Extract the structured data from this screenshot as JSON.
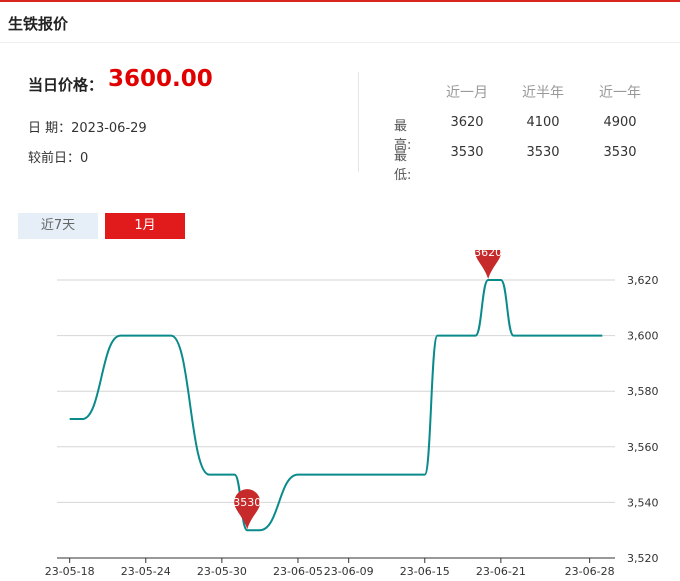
{
  "panel": {
    "title": "生铁报价"
  },
  "summary": {
    "price_label": "当日价格：",
    "price_value": "3600.00",
    "date_label": "日 期：",
    "date_value": "2023-06-29",
    "change_label": "较前日：",
    "change_value": "0"
  },
  "stats": {
    "headers": [
      "近一月",
      "近半年",
      "近一年"
    ],
    "rows": [
      {
        "label": "最高:",
        "values": [
          "3620",
          "4100",
          "4900"
        ]
      },
      {
        "label": "最低:",
        "values": [
          "3530",
          "3530",
          "3530"
        ]
      }
    ]
  },
  "tabs": [
    {
      "label": "近7天",
      "active": false
    },
    {
      "label": "1月",
      "active": true
    }
  ],
  "colors": {
    "accent": "#d7261e",
    "line": "#0a8a8a",
    "marker": "#c62a2a"
  },
  "chart_data": {
    "type": "line",
    "x_tick_labels": [
      "23-05-18",
      "23-05-24",
      "23-05-30",
      "23-06-05",
      "23-06-09",
      "23-06-15",
      "23-06-21",
      "23-06-28"
    ],
    "y_tick_labels": [
      "3,520",
      "3,540",
      "3,560",
      "3,580",
      "3,600",
      "3,620"
    ],
    "ylim": [
      3520,
      3620
    ],
    "grid": true,
    "series": [
      {
        "x": [
          "2023-05-18",
          "2023-05-19",
          "2023-05-22",
          "2023-05-23",
          "2023-05-24",
          "2023-05-25",
          "2023-05-26",
          "2023-05-29",
          "2023-05-30",
          "2023-05-31",
          "2023-06-01",
          "2023-06-02",
          "2023-06-05",
          "2023-06-06",
          "2023-06-07",
          "2023-06-08",
          "2023-06-09",
          "2023-06-12",
          "2023-06-13",
          "2023-06-14",
          "2023-06-15",
          "2023-06-16",
          "2023-06-19",
          "2023-06-20",
          "2023-06-21",
          "2023-06-22",
          "2023-06-25",
          "2023-06-26",
          "2023-06-27",
          "2023-06-28",
          "2023-06-29"
        ],
        "values": [
          3570,
          3570,
          3600,
          3600,
          3600,
          3600,
          3600,
          3550,
          3550,
          3550,
          3530,
          3530,
          3550,
          3550,
          3550,
          3550,
          3550,
          3550,
          3550,
          3550,
          3550,
          3600,
          3600,
          3620,
          3620,
          3600,
          3600,
          3600,
          3600,
          3600,
          3600
        ]
      }
    ],
    "markers": [
      {
        "label": "3620",
        "index": 23
      },
      {
        "label": "3530",
        "index": 10
      }
    ]
  }
}
